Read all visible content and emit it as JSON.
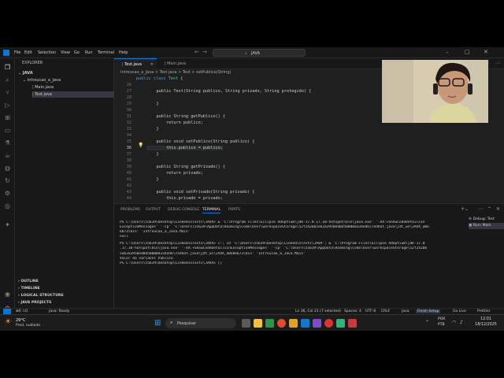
{
  "window": {
    "search": "JAVA"
  },
  "menu": [
    "File",
    "Edit",
    "Selection",
    "View",
    "Go",
    "Run",
    "Terminal",
    "Help"
  ],
  "sidebar": {
    "header": "EXPLORER",
    "root": "JAVA",
    "folder": "Introucao_a_Java",
    "files": [
      "Main.java",
      "Test.java"
    ],
    "sections": [
      "OUTLINE",
      "TIMELINE",
      "LOGICAL STRUCTURE",
      "JAVA PROJECTS"
    ]
  },
  "tabs": [
    {
      "label": "Test.java",
      "active": true
    },
    {
      "label": "Main.java",
      "active": false
    }
  ],
  "breadcrumb": "Introucao_a_Java > Test.java > Test > setPublico(String)",
  "editor": {
    "header_line": "public class Test {",
    "lines": [
      {
        "n": "26",
        "t": ""
      },
      {
        "n": "27",
        "t": "    public Test(String publico, String privado, String protegido) {"
      },
      {
        "n": "28",
        "t": ""
      },
      {
        "n": "29",
        "t": "    }"
      },
      {
        "n": "30",
        "t": ""
      },
      {
        "n": "31",
        "t": "    public String getPublico() {"
      },
      {
        "n": "32",
        "t": "        return publico;"
      },
      {
        "n": "33",
        "t": "    }"
      },
      {
        "n": "34",
        "t": ""
      },
      {
        "n": "35",
        "t": "    public void setPublico(String publico) {"
      },
      {
        "n": "36",
        "t": "        this.publico = publico;"
      },
      {
        "n": "37",
        "t": "    }"
      },
      {
        "n": "38",
        "t": ""
      },
      {
        "n": "39",
        "t": "    public String getPrivado() {"
      },
      {
        "n": "40",
        "t": "        return privado;"
      },
      {
        "n": "41",
        "t": "    }"
      },
      {
        "n": "42",
        "t": ""
      },
      {
        "n": "43",
        "t": "    public void setPrivado(String privado) {"
      },
      {
        "n": "44",
        "t": "        this.privado = privado;"
      }
    ]
  },
  "panel": {
    "tabs": [
      "PROBLEMS",
      "OUTPUT",
      "DEBUG CONSOLE",
      "TERMINAL",
      "PORTS"
    ],
    "active_tab": "TERMINAL",
    "terminal": [
      "PS C:\\Users\\55639\\Desktop\\LinkedinTests\\JAVA>  & 'C:\\Program Files\\Eclipse Adoptium\\jdk-17.0.17.10-hotspot\\bin\\java.exe' '-XX:+ShowCodeDetailsIn",
      "ExceptionMessages' '-cp' 'C:\\Users\\55639\\AppData\\Roaming\\Code\\User\\workspaceStorage\\52f242b65eb3a3950ed0d50000d334ed6\\redhat.java\\jdt_ws\\JAVA_a0e",
      "b673\\bin' 'Introucao_a_Java.Main'",
      "null",
      "PS C:\\Users\\55639\\Desktop\\LinkedinTests\\JAVA>  c:; cd 'c:\\Users\\55639\\Desktop\\LinkedinTests\\JAVA'; & 'C:\\Program Files\\Eclipse Adoptium\\jdk-17.0",
      ".17.10-hotspot\\bin\\java.exe' '-XX:+ShowCodeDetailsInExceptionMessages' '-cp' 'C:\\Users\\55639\\AppData\\Roaming\\Code\\User\\workspaceStorage\\52f242b6",
      "5eb3a3950ed0d50000d334ed6\\redhat.java\\jdt_ws\\JAVA_a0e0e673\\bin' 'Introucao_a_Java.Main'",
      "Valor da variavel Publico",
      "PS C:\\Users\\55639\\Desktop\\LinkedinTests\\JAVA> []"
    ],
    "sessions": [
      "Debug: Test",
      "Run: Main"
    ]
  },
  "status": {
    "left": "Java: Ready",
    "position": "Ln 36, Col 21 (7 selected)",
    "spaces": "Spaces: 4",
    "encoding": "UTF-8",
    "eol": "CRLF",
    "lang": "Java",
    "finish": "Finish Setup",
    "golive": "Go Live",
    "prettier": "Prettier"
  },
  "taskbar": {
    "weather_temp": "29°C",
    "weather_desc": "Pred. nublado",
    "search": "Pesquisar",
    "lang1": "POR",
    "lang2": "PTB",
    "time": "12:01",
    "date": "18/12/2025"
  },
  "colors": {
    "accent": "#0078d4",
    "bg": "#1f1f1f",
    "sidebar": "#181818"
  }
}
